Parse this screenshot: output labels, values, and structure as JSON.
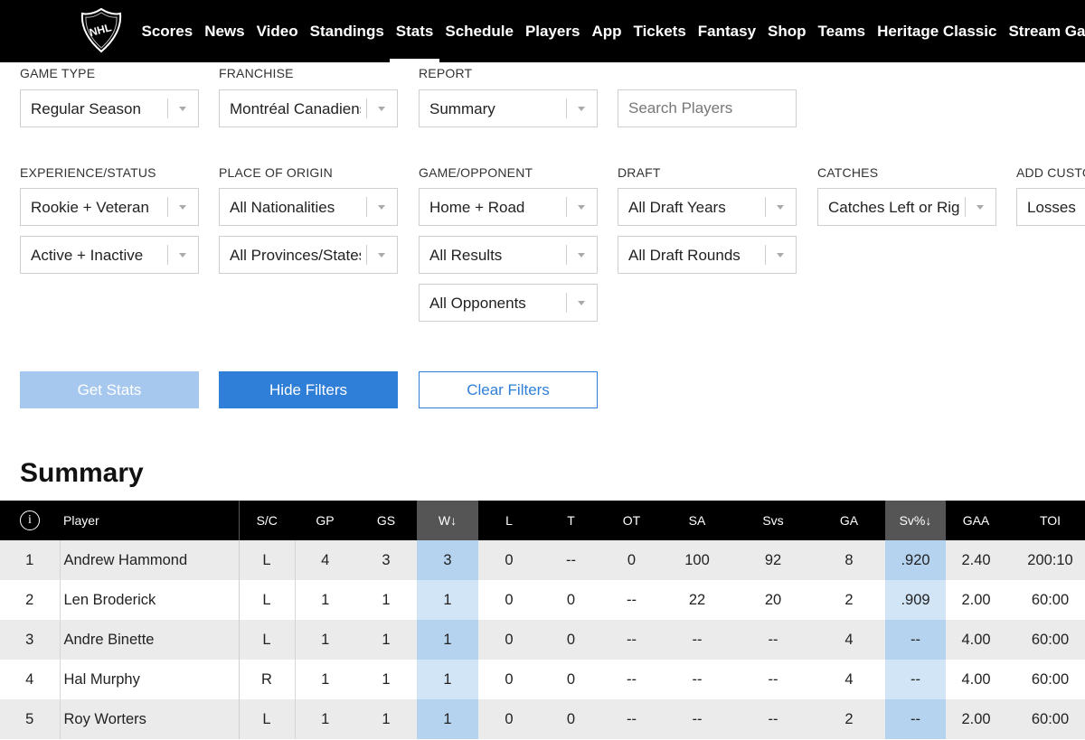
{
  "nav": {
    "items": [
      "Scores",
      "News",
      "Video",
      "Standings",
      "Stats",
      "Schedule",
      "Players",
      "App",
      "Tickets",
      "Fantasy",
      "Shop",
      "Teams",
      "Heritage Classic",
      "Stream Games"
    ],
    "active": "Stats",
    "logo_icon": "nhl-shield-logo",
    "accent": "#f0612a"
  },
  "filters": {
    "game_type": {
      "label": "GAME TYPE",
      "value": "Regular Season"
    },
    "franchise": {
      "label": "FRANCHISE",
      "value": "Montréal Canadiens"
    },
    "report": {
      "label": "REPORT",
      "value": "Summary"
    },
    "search": {
      "placeholder": "Search Players"
    },
    "experience": {
      "label": "EXPERIENCE/STATUS",
      "value1": "Rookie + Veteran",
      "value2": "Active + Inactive"
    },
    "origin": {
      "label": "PLACE OF ORIGIN",
      "value1": "All Nationalities",
      "value2": "All Provinces/States"
    },
    "game_opponent": {
      "label": "GAME/OPPONENT",
      "value1": "Home + Road",
      "value2": "All Results",
      "value3": "All Opponents"
    },
    "draft": {
      "label": "DRAFT",
      "value1": "All Draft Years",
      "value2": "All Draft Rounds"
    },
    "catches": {
      "label": "CATCHES",
      "value": "Catches Left or Rig..."
    },
    "custom": {
      "label": "ADD CUSTOM",
      "value": "Losses"
    }
  },
  "buttons": {
    "get_stats": "Get Stats",
    "hide_filters": "Hide Filters",
    "clear_filters": "Clear Filters"
  },
  "colors": {
    "primary": "#2f7fd8",
    "disabled": "#a6c8ee",
    "sorted_header": "#555555",
    "sorted_cell": "#b5d2ee"
  },
  "summary": {
    "title": "Summary",
    "columns": [
      "",
      "Player",
      "S/C",
      "GP",
      "GS",
      "W↓",
      "L",
      "T",
      "OT",
      "SA",
      "Svs",
      "GA",
      "Sv%↓",
      "GAA",
      "TOI"
    ],
    "rows": [
      [
        "1",
        "Andrew Hammond",
        "L",
        "4",
        "3",
        "3",
        "0",
        "--",
        "0",
        "100",
        "92",
        "8",
        ".920",
        "2.40",
        "200:10"
      ],
      [
        "2",
        "Len Broderick",
        "L",
        "1",
        "1",
        "1",
        "0",
        "0",
        "--",
        "22",
        "20",
        "2",
        ".909",
        "2.00",
        "60:00"
      ],
      [
        "3",
        "Andre Binette",
        "L",
        "1",
        "1",
        "1",
        "0",
        "0",
        "--",
        "--",
        "--",
        "4",
        "--",
        "4.00",
        "60:00"
      ],
      [
        "4",
        "Hal Murphy",
        "R",
        "1",
        "1",
        "1",
        "0",
        "0",
        "--",
        "--",
        "--",
        "4",
        "--",
        "4.00",
        "60:00"
      ],
      [
        "5",
        "Roy Worters",
        "L",
        "1",
        "1",
        "1",
        "0",
        "0",
        "--",
        "--",
        "--",
        "2",
        "--",
        "2.00",
        "60:00"
      ]
    ]
  }
}
